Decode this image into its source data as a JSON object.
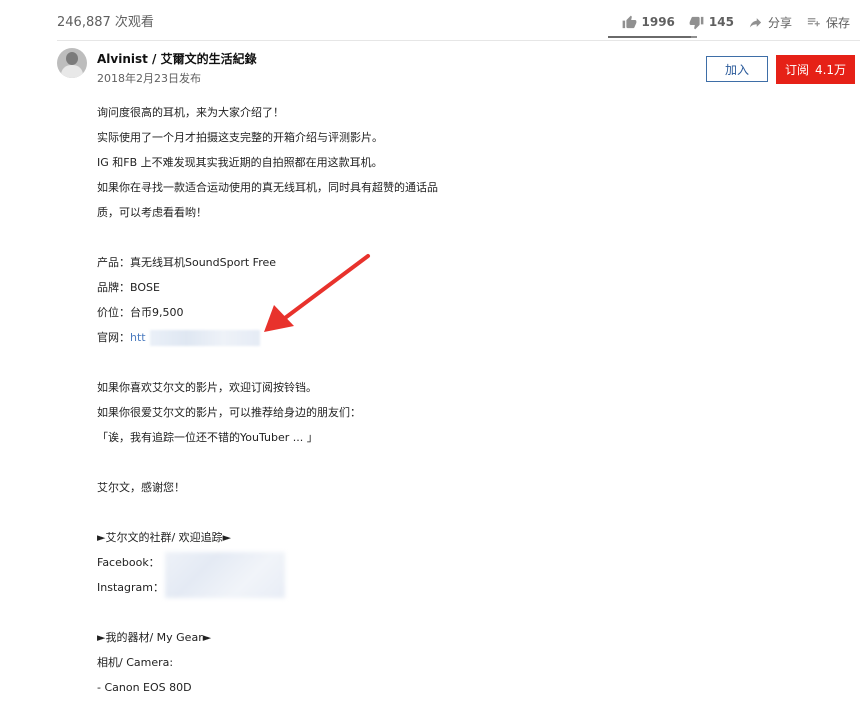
{
  "stats": {
    "views": "246,887 次观看",
    "likes": "1996",
    "dislikes": "145",
    "share": "分享",
    "save": "保存",
    "like_ratio": 0.93
  },
  "channel": {
    "name": "Alvinist / 艾爾文的生活紀錄",
    "published": "2018年2月23日发布",
    "join_label": "加入",
    "subscribe_label": "订阅",
    "subscriber_count": "4.1万"
  },
  "description": {
    "lines": [
      "询问度很高的耳机，来为大家介绍了！",
      "实际使用了一个月才拍摄这支完整的开箱介绍与评测影片。",
      "IG 和FB 上不难发现其实我近期的自拍照都在用这款耳机。",
      "如果你在寻找一款适合运动使用的真无线耳机，同时具有超赞的通话品",
      "质，可以考虑看看哟！",
      "",
      "产品：真无线耳机SoundSport Free",
      "品牌：BOSE",
      "价位：台币9,500"
    ],
    "website_label": "官网：",
    "website_prefix": "htt",
    "lines2": [
      "",
      "如果你喜欢艾尔文的影片，欢迎订阅按铃铛。",
      "如果你很爱艾尔文的影片，可以推荐给身边的朋友们：",
      "「诶，我有追踪一位还不错的YouTuber ... 」",
      "",
      "艾尔文，感谢您！",
      "",
      "►艾尔文的社群/ 欢迎追踪►",
      "Facebook：",
      "Instagram：",
      "",
      "►我的器材/ My Gear►",
      "相机/ Camera:",
      "- Canon EOS 80D"
    ]
  },
  "colors": {
    "subscribe_red": "#e62117",
    "arrow_red": "#e8322c",
    "join_blue": "#3e6ea7"
  }
}
